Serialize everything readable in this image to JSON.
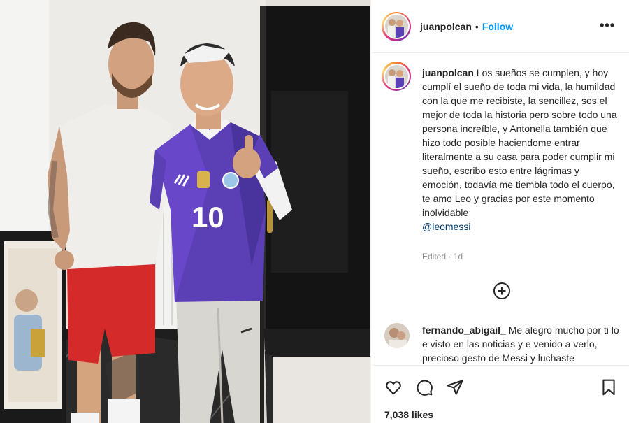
{
  "post": {
    "username": "juanpolcan",
    "separator": "•",
    "follow_label": "Follow",
    "more_label": "•••",
    "caption_text": "Los sueños se cumplen, y hoy cumplí el sueño de toda mi vida, la humildad con la que me recibiste, la sencillez, sos el mejor de toda la historia pero sobre todo una persona increíble, y Antonella también que hizo todo posible haciendome entrar literalmente a su casa para poder cumplir mi sueño, escribo esto entre lágrimas y emoción, todavía me tiembla todo el cuerpo, te amo Leo y gracias por este momento inolvidable",
    "caption_mention": "@leomessi",
    "edited_label": "Edited · 1d",
    "likes": "7,038 likes"
  },
  "comment": {
    "username": "fernando_abigail_",
    "text": "Me alegro mucho por ti lo e visto en las noticias y e venido a verlo, precioso gesto de Messi y luchaste"
  },
  "photo": {
    "jersey_number": "10"
  },
  "icons": {
    "more": "more-options-icon",
    "load_more": "plus-circle-icon",
    "like": "heart-icon",
    "comment": "comment-icon",
    "share": "paper-plane-icon",
    "save": "bookmark-icon"
  },
  "colors": {
    "link": "#0095f6",
    "mention": "#00376b",
    "muted": "#8e8e8e",
    "text": "#262626"
  }
}
